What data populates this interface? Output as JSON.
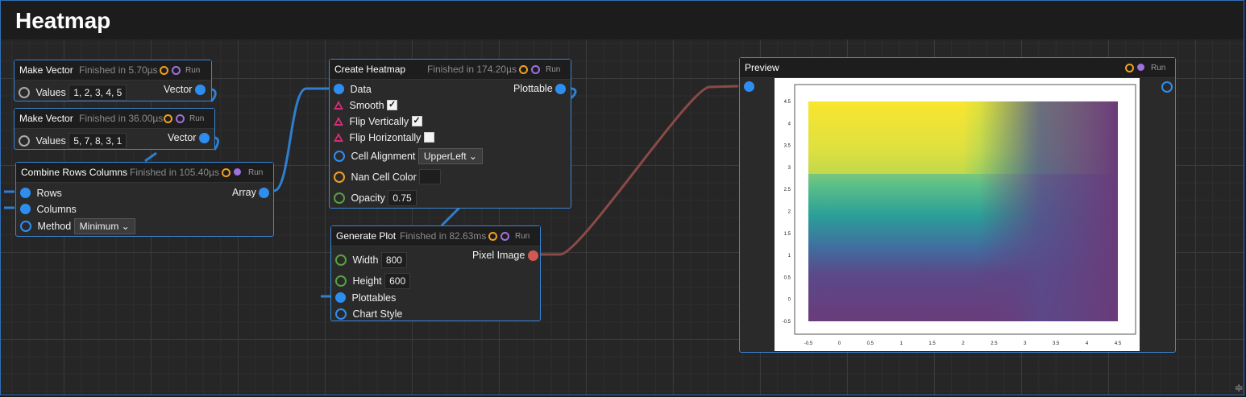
{
  "title": "Heatmap",
  "nodes": {
    "make_vector_1": {
      "title": "Make Vector",
      "status": "Finished in 5.70µs",
      "run": "Run",
      "values_label": "Values",
      "values": "1, 2, 3, 4, 5",
      "output": "Vector"
    },
    "make_vector_2": {
      "title": "Make Vector",
      "status": "Finished in 36.00µs",
      "run": "Run",
      "values_label": "Values",
      "values": "5, 7, 8, 3, 1",
      "output": "Vector"
    },
    "combine": {
      "title": "Combine Rows Columns",
      "status": "Finished in 105.40µs",
      "run": "Run",
      "rows": "Rows",
      "columns": "Columns",
      "method_label": "Method",
      "method_value": "Minimum",
      "output": "Array"
    },
    "create_heatmap": {
      "title": "Create Heatmap",
      "status": "Finished in 174.20µs",
      "run": "Run",
      "data": "Data",
      "output": "Plottable",
      "smooth": "Smooth",
      "flip_v": "Flip Vertically",
      "flip_h": "Flip Horizontally",
      "cell_alignment_label": "Cell Alignment",
      "cell_alignment_value": "UpperLeft",
      "nan_color_label": "Nan Cell Color",
      "opacity_label": "Opacity",
      "opacity_value": "0.75"
    },
    "generate_plot": {
      "title": "Generate Plot",
      "status": "Finished in 82.63ms",
      "run": "Run",
      "width_label": "Width",
      "width_value": "800",
      "height_label": "Height",
      "height_value": "600",
      "plottables": "Plottables",
      "chart_style": "Chart Style",
      "output": "Pixel Image"
    },
    "preview": {
      "title": "Preview",
      "run": "Run"
    }
  },
  "plot": {
    "x_ticks": [
      "-0.5",
      "0",
      "0.5",
      "1",
      "1.5",
      "2",
      "2.5",
      "3",
      "3.5",
      "4",
      "4.5"
    ],
    "y_ticks": [
      "4.5",
      "4",
      "3.5",
      "3",
      "2.5",
      "2",
      "1.5",
      "1",
      "0.5",
      "0",
      "-0.5"
    ]
  },
  "colors": {
    "accent": "#3a86d6",
    "wire_blue": "#2e7fd0",
    "wire_red": "#8a4a46"
  }
}
